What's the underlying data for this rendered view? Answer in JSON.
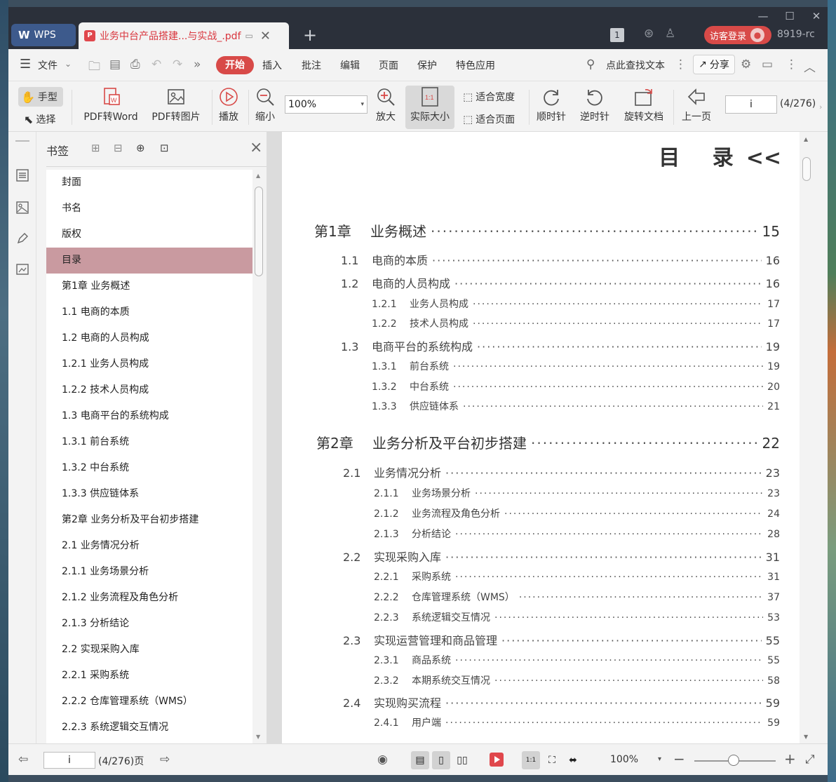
{
  "titlebar": {
    "app_tab": "WPS",
    "doc_tab": "业务中台产品搭建...与实战_.pdf",
    "badge": "1",
    "login": "访客登录",
    "user_id": "8919-rc"
  },
  "menu": {
    "file": "文件",
    "start": "开始",
    "items": [
      "插入",
      "批注",
      "编辑",
      "页面",
      "保护",
      "特色应用"
    ],
    "search": "点此查找文本",
    "share": "分享"
  },
  "toolbar": {
    "hand": "手型",
    "select": "选择",
    "pdf_word": "PDF转Word",
    "pdf_image": "PDF转图片",
    "play": "播放",
    "zoom_out": "缩小",
    "zoom_value": "100%",
    "zoom_in": "放大",
    "actual_size": "实际大小",
    "fit_width": "适合宽度",
    "fit_page": "适合页面",
    "clockwise": "顺时针",
    "counterclockwise": "逆时针",
    "rotate_doc": "旋转文档",
    "prev_page": "上一页",
    "page_input": "i",
    "page_count": "(4/276)"
  },
  "bookmarks": {
    "title": "书签",
    "items": [
      "封面",
      "书名",
      "版权",
      "目录",
      "第1章  业务概述",
      "1.1  电商的本质",
      "1.2  电商的人员构成",
      "1.2.1  业务人员构成",
      "1.2.2  技术人员构成",
      "1.3  电商平台的系统构成",
      "1.3.1  前台系统",
      "1.3.2  中台系统",
      "1.3.3  供应链体系",
      "第2章  业务分析及平台初步搭建",
      "2.1  业务情况分析",
      "2.1.1  业务场景分析",
      "2.1.2  业务流程及角色分析",
      "2.1.3  分析结论",
      "2.2  实现采购入库",
      "2.2.1  采购系统",
      "2.2.2  仓库管理系统（WMS）",
      "2.2.3  系统逻辑交互情况"
    ],
    "active_index": 3
  },
  "doc": {
    "heading": "目 录",
    "entries": [
      {
        "num": "第1章",
        "title": "业务概述",
        "page": "15",
        "level": 0
      },
      {
        "num": "1.1",
        "title": "电商的本质",
        "page": "16",
        "level": 1
      },
      {
        "num": "1.2",
        "title": "电商的人员构成",
        "page": "16",
        "level": 1
      },
      {
        "num": "1.2.1",
        "title": "业务人员构成",
        "page": "17",
        "level": 2
      },
      {
        "num": "1.2.2",
        "title": "技术人员构成",
        "page": "17",
        "level": 2
      },
      {
        "num": "1.3",
        "title": "电商平台的系统构成",
        "page": "19",
        "level": 1
      },
      {
        "num": "1.3.1",
        "title": "前台系统",
        "page": "19",
        "level": 2
      },
      {
        "num": "1.3.2",
        "title": "中台系统",
        "page": "20",
        "level": 2
      },
      {
        "num": "1.3.3",
        "title": "供应链体系",
        "page": "21",
        "level": 2
      },
      {
        "num": "第2章",
        "title": "业务分析及平台初步搭建",
        "page": "22",
        "level": 0
      },
      {
        "num": "2.1",
        "title": "业务情况分析",
        "page": "23",
        "level": 1
      },
      {
        "num": "2.1.1",
        "title": "业务场景分析",
        "page": "23",
        "level": 2
      },
      {
        "num": "2.1.2",
        "title": "业务流程及角色分析",
        "page": "24",
        "level": 2
      },
      {
        "num": "2.1.3",
        "title": "分析结论",
        "page": "28",
        "level": 2
      },
      {
        "num": "2.2",
        "title": "实现采购入库",
        "page": "31",
        "level": 1
      },
      {
        "num": "2.2.1",
        "title": "采购系统",
        "page": "31",
        "level": 2
      },
      {
        "num": "2.2.2",
        "title": "仓库管理系统（WMS）",
        "page": "37",
        "level": 2
      },
      {
        "num": "2.2.3",
        "title": "系统逻辑交互情况",
        "page": "53",
        "level": 2
      },
      {
        "num": "2.3",
        "title": "实现运营管理和商品管理",
        "page": "55",
        "level": 1
      },
      {
        "num": "2.3.1",
        "title": "商品系统",
        "page": "55",
        "level": 2
      },
      {
        "num": "2.3.2",
        "title": "本期系统交互情况",
        "page": "58",
        "level": 2
      },
      {
        "num": "2.4",
        "title": "实现购买流程",
        "page": "59",
        "level": 1
      },
      {
        "num": "2.4.1",
        "title": "用户端",
        "page": "59",
        "level": 2
      }
    ]
  },
  "status": {
    "page_input": "i",
    "page_count": "(4/276)页",
    "zoom": "100%"
  },
  "colors": {
    "accent": "#d84a48",
    "titlebar": "#2b303a",
    "bookmark_active": "#c99aa0"
  }
}
